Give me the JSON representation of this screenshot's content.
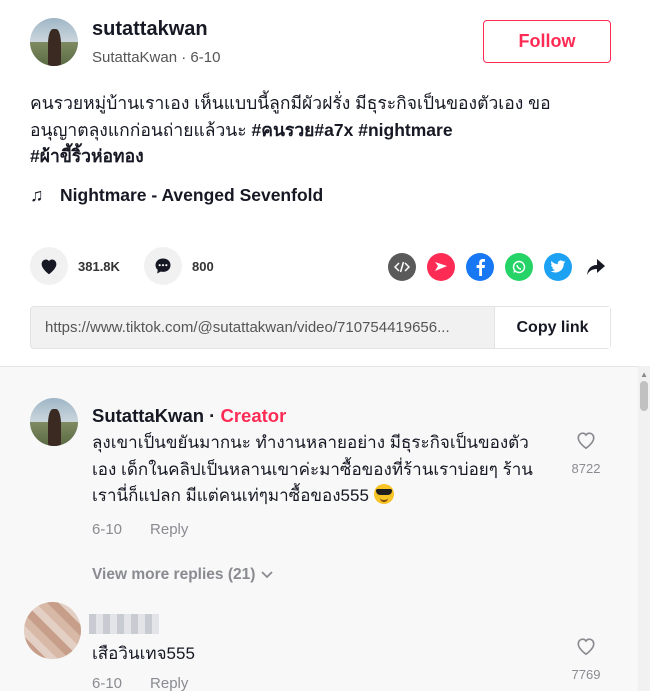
{
  "post": {
    "username": "sutattakwan",
    "display_name": "SutattaKwan",
    "separator": "·",
    "date": "6-10",
    "follow_label": "Follow",
    "caption_text": "คนรวยหมู่บ้านเราเอง เห็นแบบนี้ลูกมีผัวฝรั่ง มีธุระกิจเป็นของตัวเอง ขออนุญาตลุงแกก่อนถ่ายแล้วนะ ",
    "hashtags": [
      "#คนรวย",
      "#a7x",
      "#nightmare",
      "#ผ้าขี้ริ้วห่อทอง"
    ],
    "music": "Nightmare - Avenged Sevenfold",
    "music_icon": "♫"
  },
  "actions": {
    "likes": "381.8K",
    "comments": "800",
    "share_icons": [
      "embed-icon",
      "send-icon",
      "facebook-icon",
      "whatsapp-icon",
      "twitter-icon",
      "share-arrow-icon"
    ]
  },
  "link": {
    "url": "https://www.tiktok.com/@sutattakwan/video/710754419656...",
    "copy_label": "Copy link"
  },
  "comments": [
    {
      "name": "SutattaKwan",
      "separator": " · ",
      "badge": "Creator",
      "text": "ลุงเขาเป็นขยันมากนะ ทำงานหลายอย่าง มีธุระกิจเป็นของตัวเอง เด็กในคลิปเป็นหลานเขาค่ะมาซื้อของที่ร้านเราบ่อยๆ ร้านเรานี่ก็แปลก มีแต่คนเท่ๆมาซื้อของ555",
      "emoji": "smiling-face-with-sunglasses",
      "date": "6-10",
      "reply_label": "Reply",
      "likes": "8722",
      "view_more": "View more replies (21)"
    },
    {
      "text": "เสือวินเทจ555",
      "date": "6-10",
      "reply_label": "Reply",
      "likes": "7769"
    }
  ],
  "colors": {
    "accent": "#fe2c55",
    "muted": "#8a8b91",
    "facebook": "#1877f2",
    "whatsapp": "#25d366",
    "twitter": "#1da1f2",
    "send": "#fe2c55",
    "embed": "#5a5a5a"
  }
}
